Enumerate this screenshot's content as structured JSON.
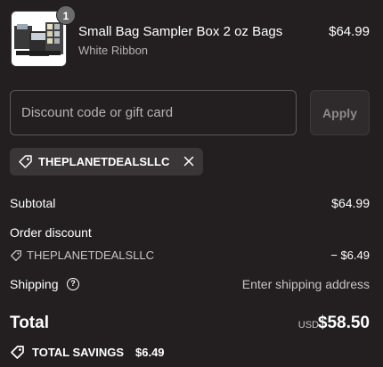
{
  "line_item": {
    "quantity": "1",
    "title": "Small Bag Sampler Box 2 oz Bags",
    "variant": "White Ribbon",
    "price": "$64.99",
    "image_icon": "product-thumbnail"
  },
  "discount": {
    "placeholder": "Discount code or gift card",
    "value": "",
    "apply_label": "Apply",
    "applied_code": "THEPLANETDEALSLLC",
    "remove_icon": "close-icon"
  },
  "summary": {
    "subtotal_label": "Subtotal",
    "subtotal_value": "$64.99",
    "order_discount_label": "Order discount",
    "discount_code": "THEPLANETDEALSLLC",
    "discount_amount": "− $6.49",
    "shipping_label": "Shipping",
    "shipping_help": "?",
    "shipping_value": "Enter shipping address",
    "total_label": "Total",
    "currency": "USD",
    "total_value": "$58.50",
    "savings_label": "TOTAL SAVINGS",
    "savings_value": "$6.49"
  },
  "colors": {
    "background": "#231f20",
    "chip": "#3a3637",
    "border": "#5c5758",
    "muted_text": "#c9c4c5"
  }
}
